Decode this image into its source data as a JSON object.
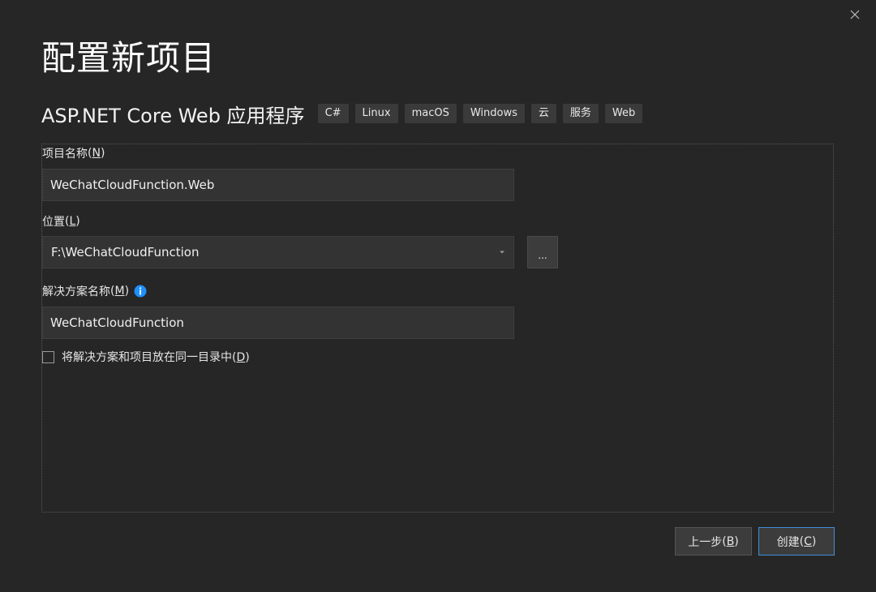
{
  "window": {
    "title": "配置新项目",
    "close_icon": "close-icon"
  },
  "template": {
    "name": "ASP.NET Core Web 应用程序",
    "tags": [
      "C#",
      "Linux",
      "macOS",
      "Windows",
      "云",
      "服务",
      "Web"
    ]
  },
  "form": {
    "project_name": {
      "label": "项目名称",
      "access_key": "N",
      "value": "WeChatCloudFunction.Web"
    },
    "location": {
      "label": "位置",
      "access_key": "L",
      "value": "F:\\WeChatCloudFunction",
      "browse_label": "..."
    },
    "solution_name": {
      "label": "解决方案名称",
      "access_key": "M",
      "value": "WeChatCloudFunction",
      "info_icon": "info-icon"
    },
    "same_directory": {
      "label": "将解决方案和项目放在同一目录中",
      "access_key": "D",
      "checked": false
    }
  },
  "buttons": {
    "back": {
      "label": "上一步",
      "access_key": "B"
    },
    "create": {
      "label": "创建",
      "access_key": "C"
    }
  },
  "colors": {
    "background": "#262626",
    "input_bg": "#333333",
    "accent": "#3f8fd8",
    "info": "#1e90ff"
  }
}
